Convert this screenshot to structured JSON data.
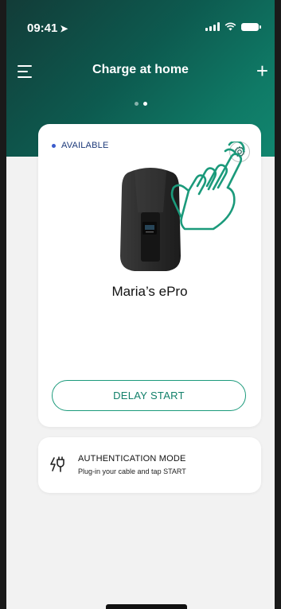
{
  "status_bar": {
    "time": "09:41",
    "location_icon": "location-arrow-icon",
    "signal_icon": "signal-icon",
    "wifi_icon": "wifi-icon",
    "battery_icon": "battery-icon"
  },
  "header": {
    "title": "Charge at home",
    "menu_icon": "hamburger-menu-icon",
    "add_icon": "plus-icon",
    "page_count": 2,
    "active_page": 2
  },
  "charger": {
    "status": "AVAILABLE",
    "status_color": "#3b5bcc",
    "settings_icon": "gear-icon",
    "name": "Maria’s ePro",
    "delay_button": "DELAY START"
  },
  "auth": {
    "icon": "plug-authentication-icon",
    "title": "AUTHENTICATION MODE",
    "subtitle": "Plug-in your cable and tap START"
  },
  "colors": {
    "accent": "#1b9a7b",
    "header_dark": "#123c38",
    "header_light": "#11866f"
  }
}
